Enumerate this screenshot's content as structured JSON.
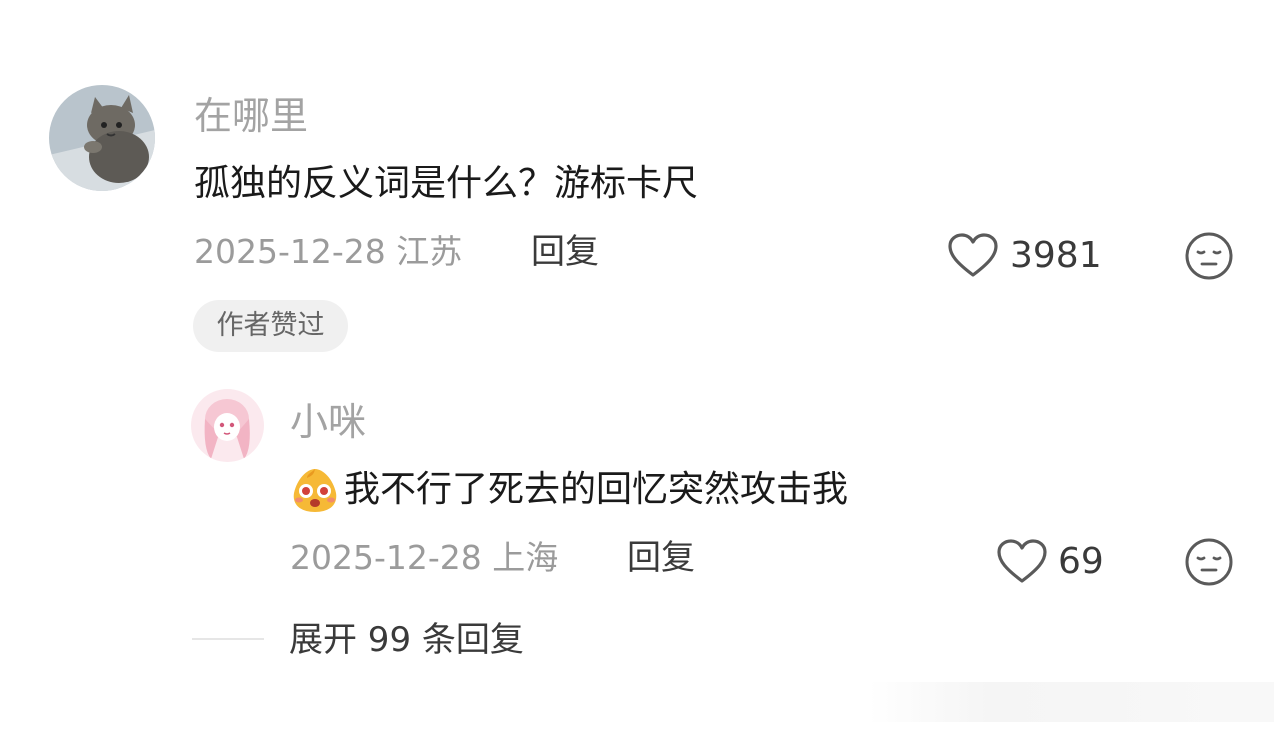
{
  "comment": {
    "username": "在哪里",
    "text": "孤独的反义词是什么？游标卡尺",
    "meta": "2025-12-28 江苏",
    "reply_label": "回复",
    "likes": "3981",
    "author_badge": "作者赞过",
    "avatar_icon": "cat-avatar"
  },
  "reply": {
    "username": "小咪",
    "text": "我不行了死去的回忆突然攻击我",
    "emoji_icon": "surprised-face-emoji",
    "meta": "2025-12-28 上海",
    "reply_label": "回复",
    "likes": "69",
    "avatar_icon": "anime-girl-avatar"
  },
  "expand": {
    "label": "展开 99 条回复"
  },
  "colors": {
    "text_primary": "#1a1a1a",
    "text_secondary": "#9b9b9b",
    "badge_bg": "#f0f0f0"
  }
}
